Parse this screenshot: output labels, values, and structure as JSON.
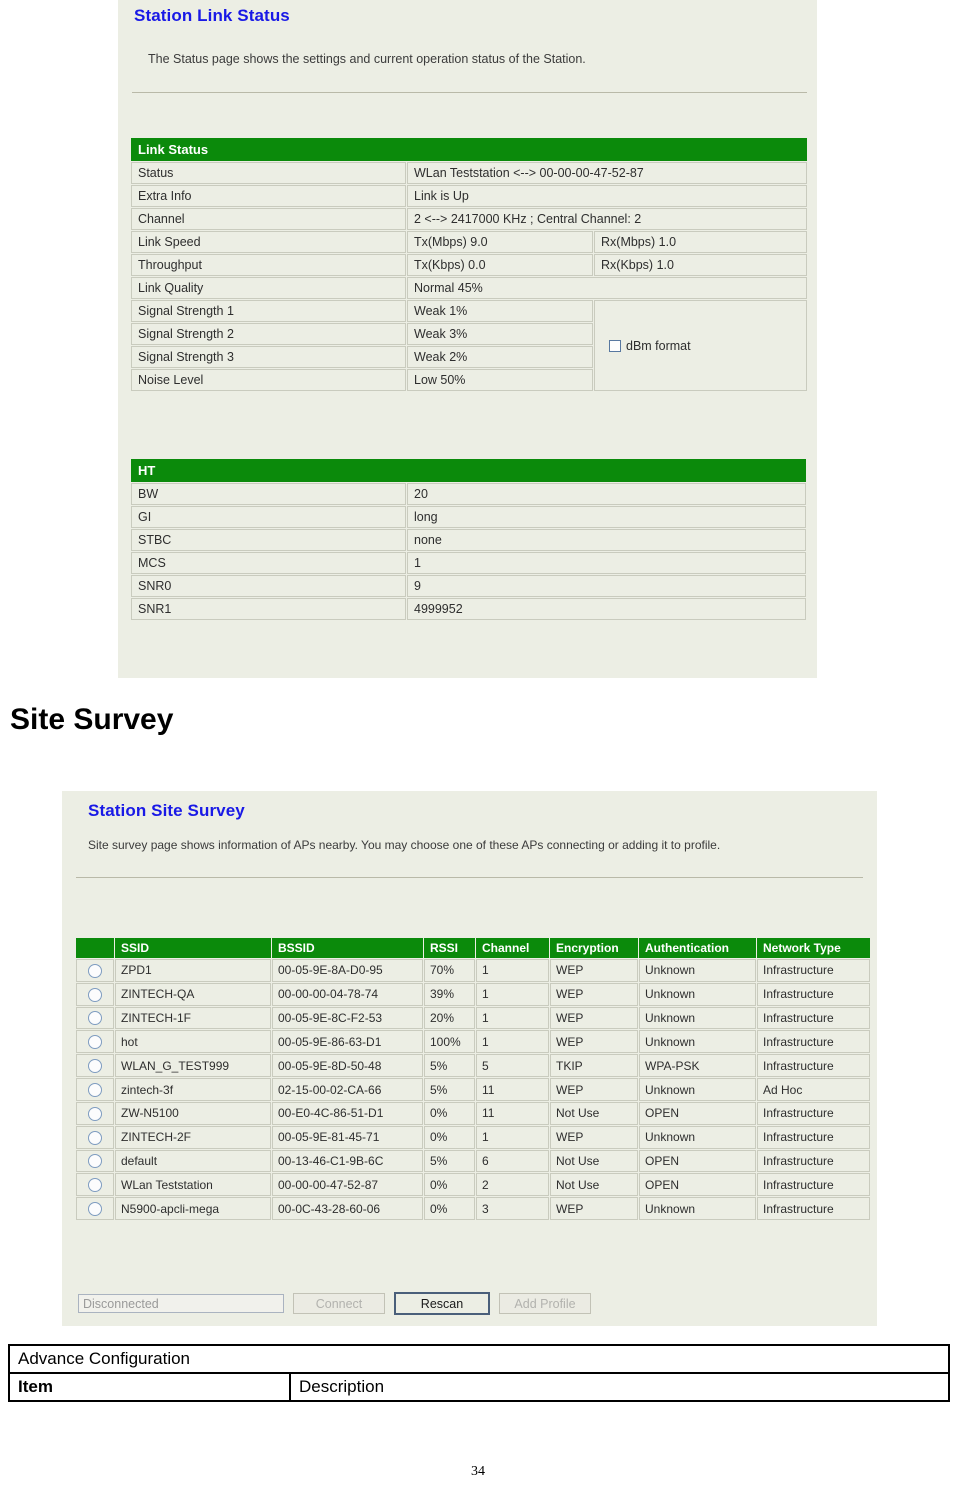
{
  "link_status_panel": {
    "title": "Station Link Status",
    "description": "The Status page shows the settings and current operation status of the Station.",
    "section_link_status": "Link Status",
    "section_ht": "HT",
    "dbm_checkbox_label": "dBm format",
    "link_rows": [
      {
        "label": "Status",
        "value": "WLan Teststation <--> 00-00-00-47-52-87"
      },
      {
        "label": "Extra Info",
        "value": "Link is Up"
      },
      {
        "label": "Channel",
        "value": "2 <--> 2417000 KHz ; Central Channel: 2"
      },
      {
        "label": "Link Speed",
        "value": "Tx(Mbps)  9.0",
        "value2": "Rx(Mbps)  1.0"
      },
      {
        "label": "Throughput",
        "value": "Tx(Kbps)  0.0",
        "value2": "Rx(Kbps)  1.0"
      },
      {
        "label": "Link Quality",
        "value": "Normal     45%"
      },
      {
        "label": "Signal Strength 1",
        "value": "Weak     1%"
      },
      {
        "label": "Signal Strength 2",
        "value": "Weak     3%"
      },
      {
        "label": "Signal Strength 3",
        "value": "Weak     2%"
      },
      {
        "label": "Noise Level",
        "value": "Low     50%"
      }
    ],
    "ht_rows": [
      {
        "label": "BW",
        "value": "20"
      },
      {
        "label": "GI",
        "value": "long"
      },
      {
        "label": "STBC",
        "value": "none"
      },
      {
        "label": "MCS",
        "value": "1"
      },
      {
        "label": "SNR0",
        "value": "9"
      },
      {
        "label": "SNR1",
        "value": "4999952"
      }
    ]
  },
  "site_survey_heading": "Site Survey",
  "site_survey_panel": {
    "title": "Station Site Survey",
    "description": "Site survey page shows information of APs nearby. You may choose one of these APs connecting or adding it to profile.",
    "columns": [
      "",
      "SSID",
      "BSSID",
      "RSSI",
      "Channel",
      "Encryption",
      "Authentication",
      "Network Type"
    ],
    "rows": [
      {
        "ssid": "ZPD1",
        "bssid": "00-05-9E-8A-D0-95",
        "rssi": "70%",
        "channel": "1",
        "encryption": "WEP",
        "auth": "Unknown",
        "network": "Infrastructure"
      },
      {
        "ssid": "ZINTECH-QA",
        "bssid": "00-00-00-04-78-74",
        "rssi": "39%",
        "channel": "1",
        "encryption": "WEP",
        "auth": "Unknown",
        "network": "Infrastructure"
      },
      {
        "ssid": "ZINTECH-1F",
        "bssid": "00-05-9E-8C-F2-53",
        "rssi": "20%",
        "channel": "1",
        "encryption": "WEP",
        "auth": "Unknown",
        "network": "Infrastructure"
      },
      {
        "ssid": "hot",
        "bssid": "00-05-9E-86-63-D1",
        "rssi": "100%",
        "channel": "1",
        "encryption": "WEP",
        "auth": "Unknown",
        "network": "Infrastructure"
      },
      {
        "ssid": "WLAN_G_TEST999",
        "bssid": "00-05-9E-8D-50-48",
        "rssi": "5%",
        "channel": "5",
        "encryption": "TKIP",
        "auth": "WPA-PSK",
        "network": "Infrastructure"
      },
      {
        "ssid": "zintech-3f",
        "bssid": "02-15-00-02-CA-66",
        "rssi": "5%",
        "channel": "11",
        "encryption": "WEP",
        "auth": "Unknown",
        "network": "Ad Hoc"
      },
      {
        "ssid": "ZW-N5100",
        "bssid": "00-E0-4C-86-51-D1",
        "rssi": "0%",
        "channel": "11",
        "encryption": "Not Use",
        "auth": "OPEN",
        "network": "Infrastructure"
      },
      {
        "ssid": "ZINTECH-2F",
        "bssid": "00-05-9E-81-45-71",
        "rssi": "0%",
        "channel": "1",
        "encryption": "WEP",
        "auth": "Unknown",
        "network": "Infrastructure"
      },
      {
        "ssid": "default",
        "bssid": "00-13-46-C1-9B-6C",
        "rssi": "5%",
        "channel": "6",
        "encryption": "Not Use",
        "auth": "OPEN",
        "network": "Infrastructure"
      },
      {
        "ssid": "WLan Teststation",
        "bssid": "00-00-00-47-52-87",
        "rssi": "0%",
        "channel": "2",
        "encryption": "Not Use",
        "auth": "OPEN",
        "network": "Infrastructure"
      },
      {
        "ssid": "N5900-apcli-mega",
        "bssid": "00-0C-43-28-60-06",
        "rssi": "0%",
        "channel": "3",
        "encryption": "WEP",
        "auth": "Unknown",
        "network": "Infrastructure"
      }
    ],
    "status_value": "Disconnected",
    "connect_label": "Connect",
    "rescan_label": "Rescan",
    "add_profile_label": "Add Profile"
  },
  "advance_table": {
    "title": "Advance Configuration",
    "col_item": "Item",
    "col_description": "Description"
  },
  "page_number": "34",
  "colors": {
    "section_green": "#0b8a0b",
    "panel_bg": "#eceee4",
    "title_blue": "#1919e6"
  }
}
